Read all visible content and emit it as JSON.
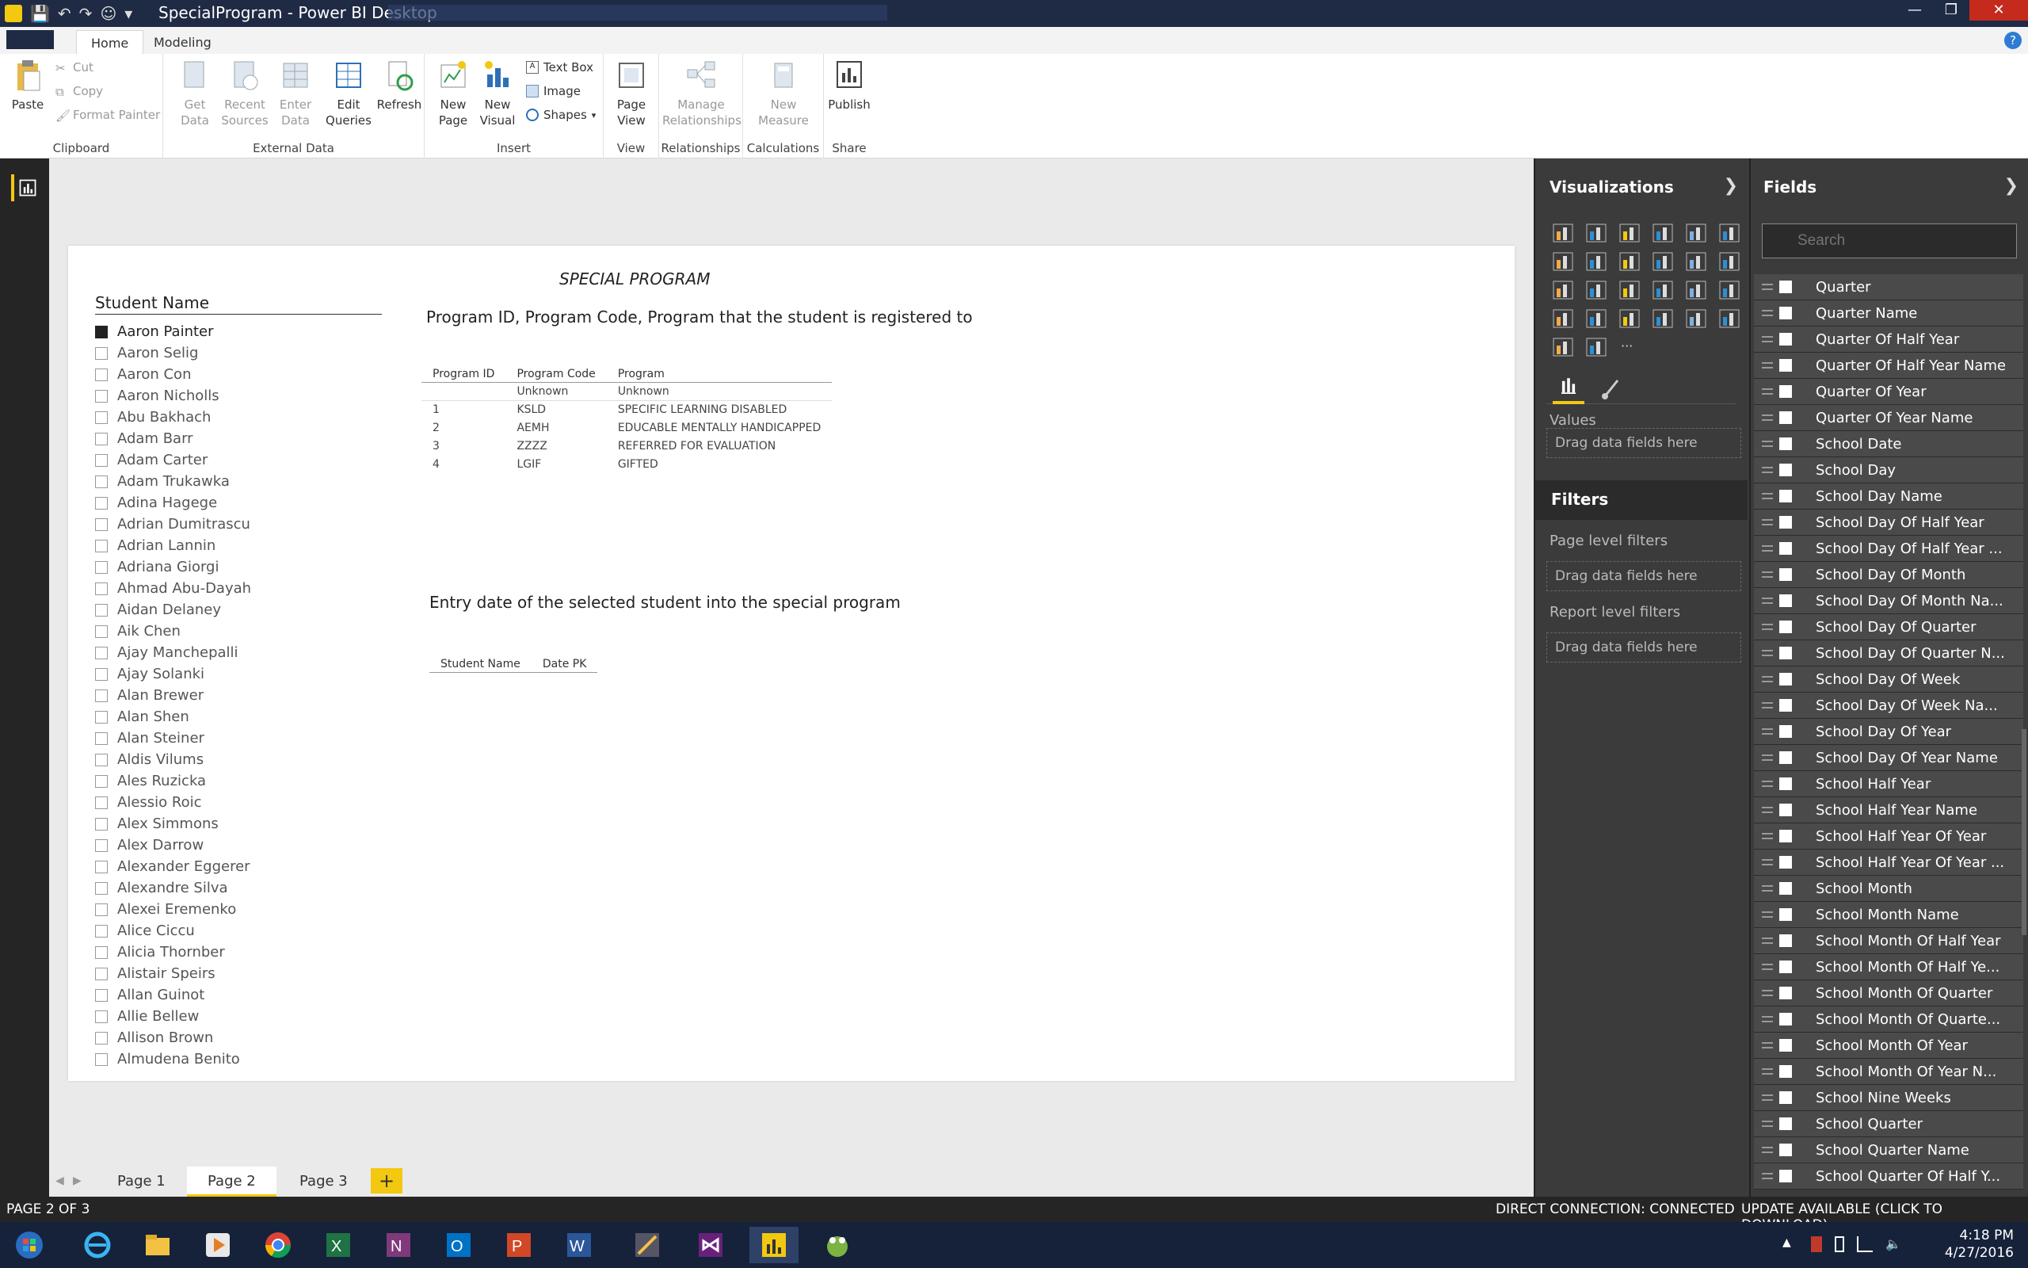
{
  "window": {
    "title": "SpecialProgram - Power BI Desktop"
  },
  "ribbon": {
    "tabs": [
      "Home",
      "Modeling"
    ],
    "groups": {
      "clipboard": {
        "label": "Clipboard",
        "paste": "Paste",
        "cut": "Cut",
        "copy": "Copy",
        "format_painter": "Format Painter"
      },
      "external_data": {
        "label": "External Data",
        "get_data_1": "Get",
        "get_data_2": "Data",
        "recent_1": "Recent",
        "recent_2": "Sources",
        "enter_1": "Enter",
        "enter_2": "Data",
        "edit_1": "Edit",
        "edit_2": "Queries",
        "refresh": "Refresh"
      },
      "insert": {
        "label": "Insert",
        "new_page_1": "New",
        "new_page_2": "Page",
        "new_visual_1": "New",
        "new_visual_2": "Visual",
        "text_box": "Text Box",
        "image": "Image",
        "shapes": "Shapes"
      },
      "view": {
        "label": "View",
        "page_view_1": "Page",
        "page_view_2": "View"
      },
      "relationships": {
        "label": "Relationships",
        "manage_1": "Manage",
        "manage_2": "Relationships"
      },
      "calculations": {
        "label": "Calculations",
        "new_measure_1": "New",
        "new_measure_2": "Measure"
      },
      "share": {
        "label": "Share",
        "publish": "Publish"
      }
    }
  },
  "report": {
    "slicer": {
      "title": "Student Name",
      "items": [
        "Aaron Painter",
        "Aaron Selig",
        "Aaron Con",
        "Aaron Nicholls",
        "Abu Bakhach",
        "Adam Barr",
        "Adam Carter",
        "Adam Trukawka",
        "Adina Hagege",
        "Adrian Dumitrascu",
        "Adrian Lannin",
        "Adriana Giorgi",
        "Ahmad Abu-Dayah",
        "Aidan Delaney",
        "Aik Chen",
        "Ajay Manchepalli",
        "Ajay Solanki",
        "Alan Brewer",
        "Alan Shen",
        "Alan Steiner",
        "Aldis Vilums",
        "Ales Ruzicka",
        "Alessio Roic",
        "Alex Simmons",
        "Alex Darrow",
        "Alexander Eggerer",
        "Alexandre Silva",
        "Alexei Eremenko",
        "Alice Ciccu",
        "Alicia Thornber",
        "Alistair Speirs",
        "Allan Guinot",
        "Allie Bellew",
        "Allison Brown",
        "Almudena Benito"
      ],
      "selected_index": 0
    },
    "header_title": "SPECIAL PROGRAM",
    "table1": {
      "title": "Program ID, Program Code, Program that the student is registered to",
      "columns": [
        "Program ID",
        "Program Code",
        "Program"
      ],
      "rows": [
        [
          "",
          "Unknown",
          "Unknown"
        ],
        [
          "1",
          "KSLD",
          "SPECIFIC LEARNING DISABLED"
        ],
        [
          "2",
          "AEMH",
          "EDUCABLE MENTALLY HANDICAPPED"
        ],
        [
          "3",
          "ZZZZ",
          "REFERRED FOR EVALUATION"
        ],
        [
          "4",
          "LGIF",
          "GIFTED"
        ]
      ]
    },
    "table2": {
      "title": "Entry date of the selected student into the special program",
      "columns": [
        "Student Name",
        "Date PK"
      ]
    }
  },
  "page_tabs": [
    "Page 1",
    "Page 2",
    "Page 3"
  ],
  "active_page": "Page 2",
  "add_page": "+",
  "visualizations": {
    "title": "Visualizations",
    "values_label": "Values",
    "drag_here": "Drag data fields here",
    "filters_title": "Filters",
    "page_filters": "Page level filters",
    "page_drag": "Drag data fields here",
    "report_filters": "Report level filters",
    "report_drag": "Drag data fields here",
    "more": "···"
  },
  "fields": {
    "title": "Fields",
    "search_placeholder": "Search",
    "items": [
      "Quarter",
      "Quarter Name",
      "Quarter Of Half Year",
      "Quarter Of Half Year Name",
      "Quarter Of Year",
      "Quarter Of Year Name",
      "School Date",
      "School Day",
      "School Day Name",
      "School Day Of Half Year",
      "School Day Of Half Year ...",
      "School Day Of Month",
      "School Day Of Month Na...",
      "School Day Of Quarter",
      "School Day Of Quarter N...",
      "School Day Of Week",
      "School Day Of Week Na...",
      "School Day Of Year",
      "School Day Of Year Name",
      "School Half Year",
      "School Half Year Name",
      "School Half Year Of Year",
      "School Half Year Of Year ...",
      "School Month",
      "School Month Name",
      "School Month Of Half Year",
      "School Month Of Half Ye...",
      "School Month Of Quarter",
      "School Month Of Quarte...",
      "School Month Of Year",
      "School Month Of Year N...",
      "School Nine Weeks",
      "School Quarter",
      "School Quarter Name",
      "School Quarter Of Half Y..."
    ]
  },
  "status": {
    "page_info": "PAGE 2 OF 3",
    "connection": "DIRECT CONNECTION: CONNECTED",
    "update": "UPDATE AVAILABLE (CLICK TO DOWNLOAD)"
  },
  "taskbar": {
    "time": "4:18 PM",
    "date": "4/27/2016"
  },
  "colors": {
    "accent": "#f2c811",
    "pane_bg": "#3b3b3b",
    "title_bg": "#1f2a44"
  }
}
